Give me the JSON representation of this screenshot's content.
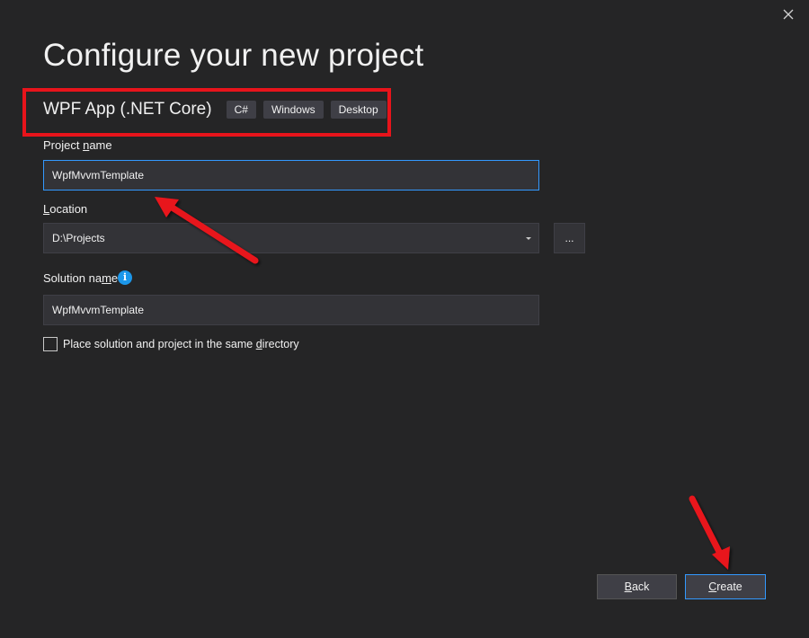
{
  "dialog": {
    "title": "Configure your new project"
  },
  "template": {
    "name": "WPF App (.NET Core)",
    "tags": [
      "C#",
      "Windows",
      "Desktop"
    ]
  },
  "project_name": {
    "label_pre": "Project ",
    "label_access": "n",
    "label_post": "ame",
    "value": "WpfMvvmTemplate"
  },
  "location": {
    "label_access": "L",
    "label_post": "ocation",
    "value": "D:\\Projects",
    "browse_label": "..."
  },
  "solution_name": {
    "label_pre": "Solution na",
    "label_access": "m",
    "label_post": "e",
    "value": "WpfMvvmTemplate",
    "info_glyph": "i"
  },
  "same_directory": {
    "label_pre": "Place solution and project in the same ",
    "label_access": "d",
    "label_post": "irectory",
    "checked": false
  },
  "buttons": {
    "back_access": "B",
    "back_post": "ack",
    "create_access": "C",
    "create_post": "reate"
  },
  "colors": {
    "background": "#252526",
    "input_background": "#333337",
    "focus_border": "#3399ff",
    "annotation_red": "#e8141b",
    "info_blue": "#1c97ea"
  },
  "icons": {
    "close": "close-icon",
    "dropdown": "chevron-down-icon",
    "info": "info-icon"
  }
}
